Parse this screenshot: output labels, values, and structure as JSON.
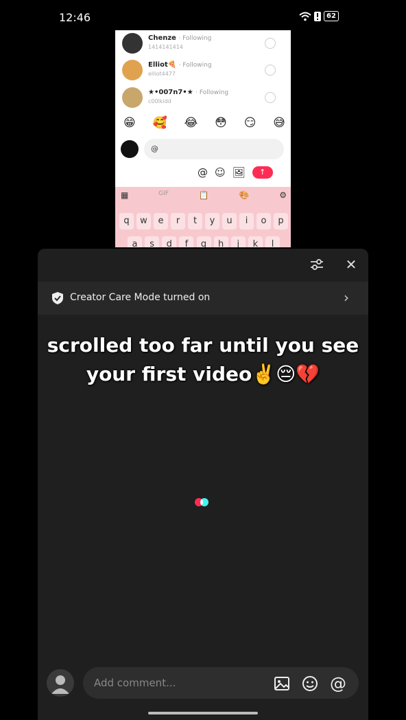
{
  "status": {
    "time": "12:46",
    "battery": "62"
  },
  "inset": {
    "users": [
      {
        "name": "Chenze",
        "status": "· Following",
        "handle": "1414141414"
      },
      {
        "name": "Elliot🍕",
        "status": "· Following",
        "handle": "elliot4477"
      },
      {
        "name": "★•007n7•★",
        "status": "· Following",
        "handle": "c00lkidd"
      }
    ],
    "emojis": [
      "😁",
      "🥰",
      "😂",
      "😳",
      "😏",
      "😅"
    ],
    "input_value": "@",
    "tools": [
      "@",
      "☺",
      "🖼"
    ],
    "keyboard": {
      "top": [
        "▦",
        "GIF",
        "📋",
        "🎨",
        "⚙"
      ],
      "row1": [
        "q",
        "w",
        "e",
        "r",
        "t",
        "y",
        "u",
        "i",
        "o",
        "p"
      ],
      "row2": [
        "a",
        "s",
        "d",
        "f",
        "g",
        "h",
        "j",
        "k",
        "l"
      ]
    }
  },
  "sheet": {
    "care_label": "Creator Care Mode turned on",
    "overlay_line1": "scrolled too far until you see",
    "overlay_line2": "your first video✌️😔💔",
    "comment_placeholder": "Add comment..."
  },
  "colors": {
    "accent": "#fe2c55",
    "accent2": "#25f4ee",
    "sheet_bg": "#1f1f1f"
  }
}
